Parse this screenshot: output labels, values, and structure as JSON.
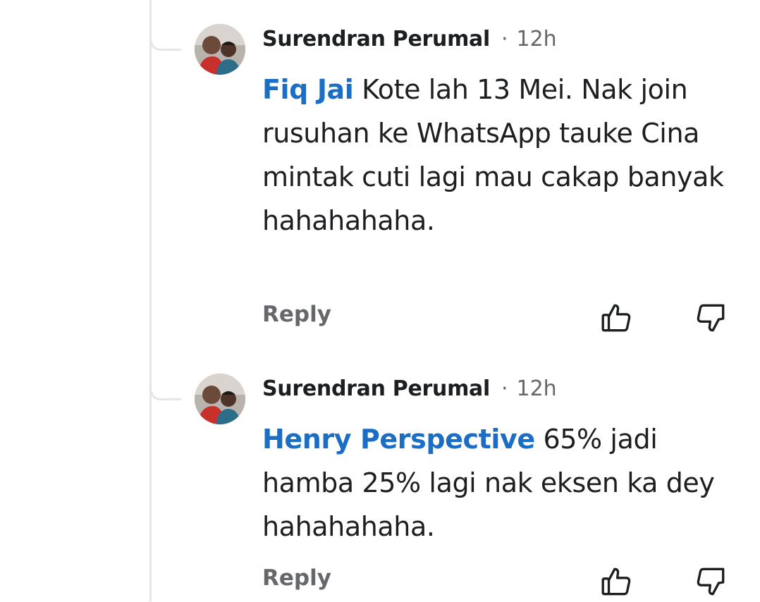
{
  "comments": [
    {
      "author": "Surendran Perumal",
      "separator": "·",
      "time": "12h",
      "mention": "Fiq Jai",
      "text": "Kote lah 13 Mei. Nak join rusuhan ke WhatsApp tauke Cina mintak cuti lagi mau cakap banyak hahahahaha.",
      "reply_label": "Reply",
      "like_icon": "thumbs-up-outline-icon",
      "dislike_icon": "thumbs-down-outline-icon"
    },
    {
      "author": "Surendran Perumal",
      "separator": "·",
      "time": "12h",
      "mention": "Henry Perspective",
      "text": "65% jadi hamba 25% lagi nak eksen ka dey hahahahaha.",
      "reply_label": "Reply",
      "like_icon": "thumbs-up-outline-icon",
      "dislike_icon": "thumbs-down-outline-icon"
    }
  ],
  "colors": {
    "mention": "#1a6ec5",
    "text": "#1c1e21",
    "muted": "#65676b",
    "thread_line": "#e4e6ea"
  }
}
